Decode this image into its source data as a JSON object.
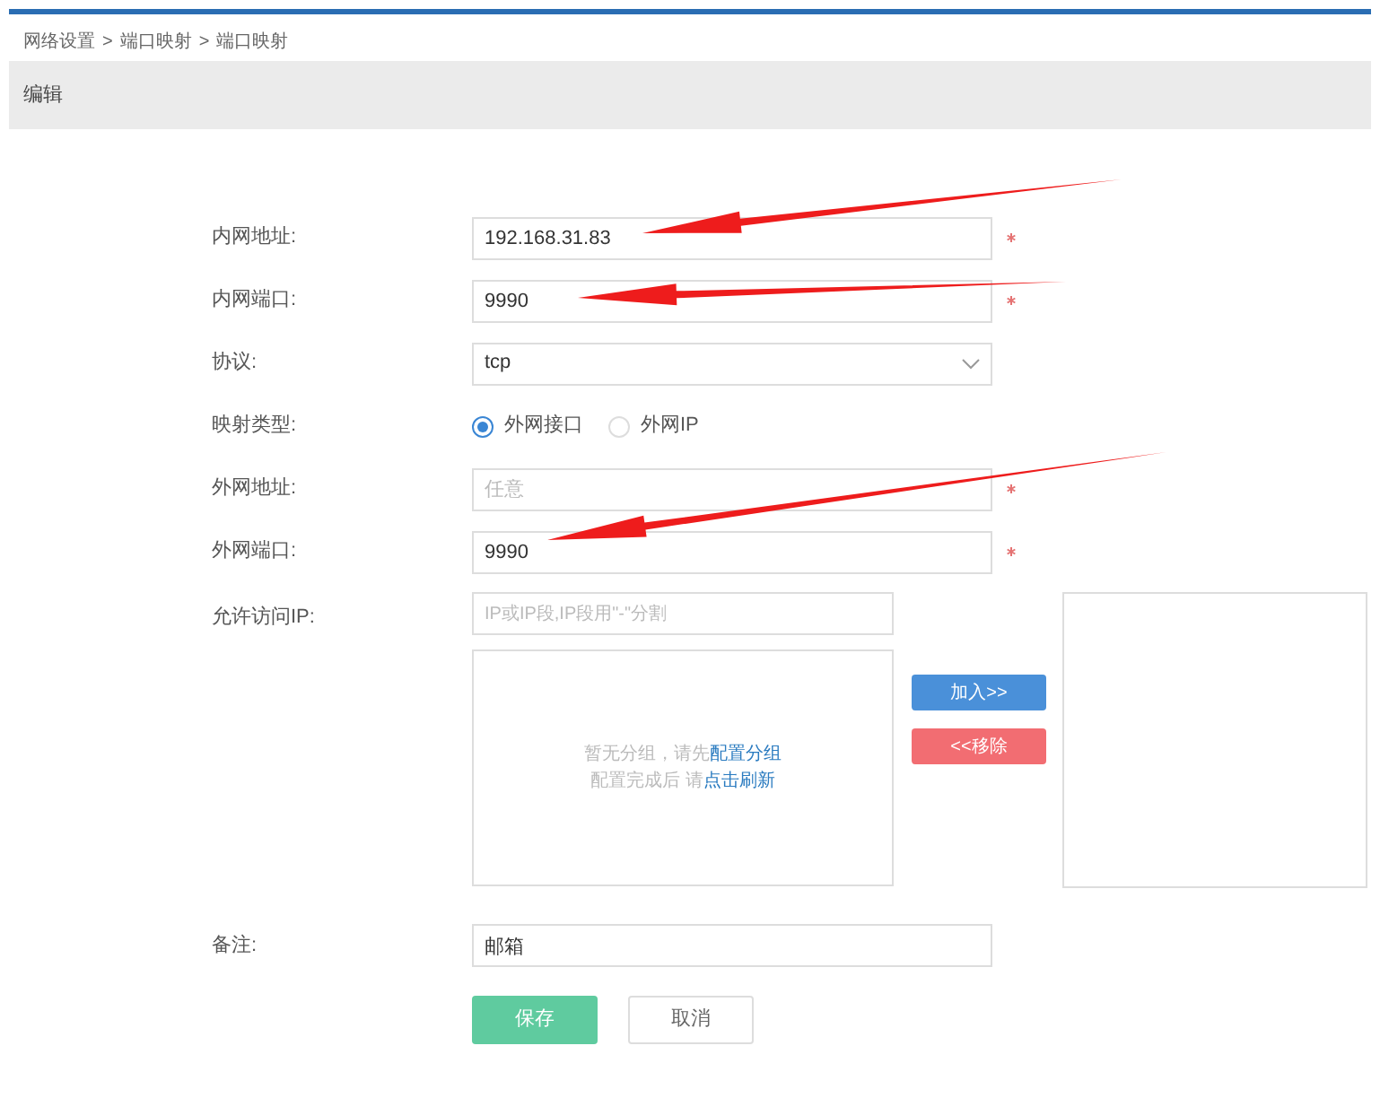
{
  "breadcrumb": [
    "网络设置",
    ">",
    "端口映射",
    ">",
    "端口映射"
  ],
  "panel_title": "编辑",
  "fields": [
    {
      "kind": "text",
      "label": "内网地址:",
      "value": "192.168.31.83",
      "required": true
    },
    {
      "kind": "text",
      "label": "内网端口:",
      "value": "9990",
      "required": true
    },
    {
      "kind": "select",
      "label": "协议:",
      "value": "tcp",
      "required": false
    },
    {
      "kind": "radio",
      "label": "映射类型:",
      "options": [
        {
          "label": "外网接口",
          "selected": true
        },
        {
          "label": "外网IP",
          "selected": false
        }
      ]
    },
    {
      "kind": "text",
      "label": "外网地址:",
      "placeholder": "任意",
      "required": true
    },
    {
      "kind": "text",
      "label": "外网端口:",
      "value": "9990",
      "required": true
    }
  ],
  "allowed_ip": {
    "label": "允许访问IP:",
    "placeholder": "IP或IP段,IP段用\"-\"分割",
    "empty_message": "暂无分组，请先**配置分组**",
    "refresh_message": "配置完成后 请**点击刷新**",
    "add_button": "加入>>",
    "remove_button": "<<移除"
  },
  "note": {
    "label": "备注:",
    "value": "邮箱"
  },
  "buttons": {
    "save": "保存",
    "cancel": "取消"
  }
}
